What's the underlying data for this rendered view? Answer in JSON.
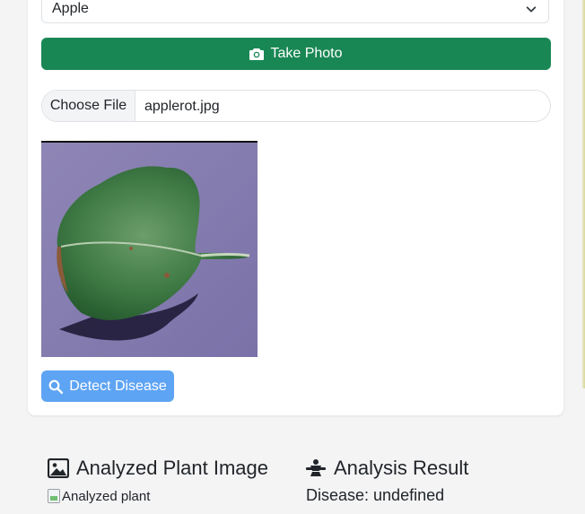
{
  "crop_select": {
    "selected": "Apple"
  },
  "take_photo": {
    "label": "Take Photo",
    "icon": "camera-icon"
  },
  "file_input": {
    "button_label": "Choose File",
    "file_name": "applerot.jpg"
  },
  "detect": {
    "label": "Detect Disease",
    "icon": "search-icon"
  },
  "sections": {
    "analyzed_image": {
      "title": "Analyzed Plant Image",
      "icon": "image-icon",
      "alt_text": "Analyzed plant"
    },
    "result": {
      "title": "Analysis Result",
      "icon": "microscope-icon",
      "disease_text": "Disease: undefined"
    }
  },
  "colors": {
    "success": "#198754",
    "primary_light": "#5ea4f4",
    "card": "#ffffff",
    "page": "#f4f4f5"
  }
}
